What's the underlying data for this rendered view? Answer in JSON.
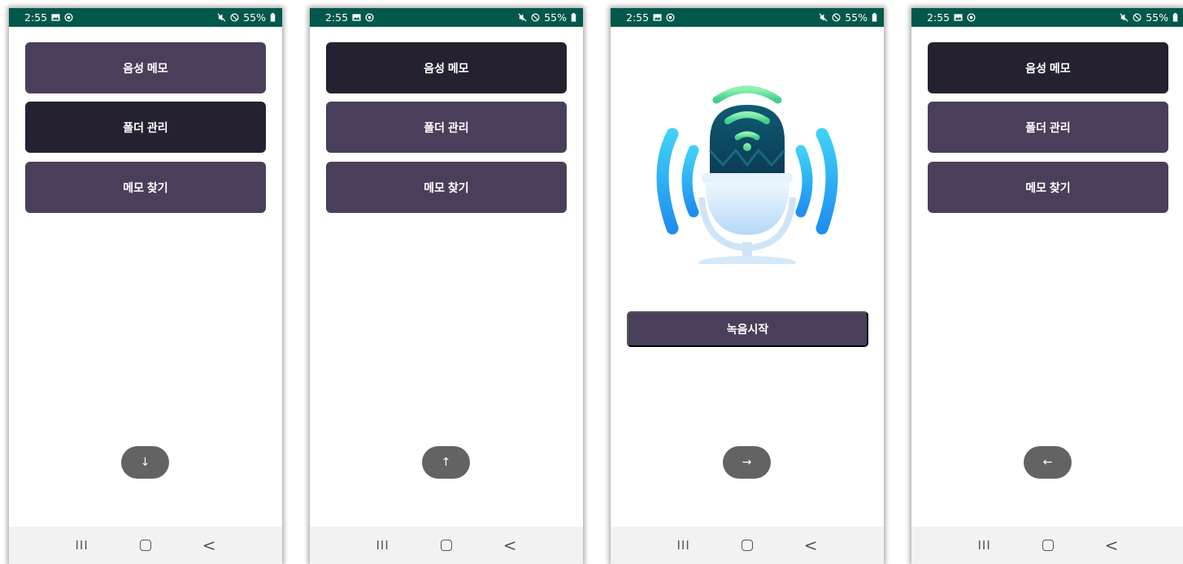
{
  "status_bar": {
    "time": "2:55",
    "battery": "55%"
  },
  "screens": [
    {
      "buttons": [
        "음성 메모",
        "폴더 관리",
        "메모 찾기"
      ],
      "fab_label": "↓"
    },
    {
      "buttons": [
        "음성 메모",
        "폴더 관리",
        "메모 찾기"
      ],
      "fab_label": "↑"
    },
    {
      "record_label": "녹음시작",
      "fab_label": "→"
    },
    {
      "buttons": [
        "음성 메모",
        "폴더 관리",
        "메모 찾기"
      ],
      "fab_label": "←"
    }
  ],
  "nav": {
    "recents": "III",
    "back": "<"
  },
  "colors": {
    "statusbar": "#02584a",
    "button_light": "#4a3f5a",
    "button_dark": "#262130",
    "fab": "#636363"
  },
  "icons": [
    "gallery-icon",
    "sync-icon",
    "mute-icon",
    "dnd-icon",
    "battery-icon",
    "microphone-icon"
  ]
}
